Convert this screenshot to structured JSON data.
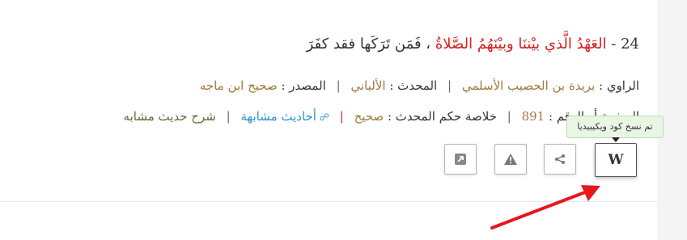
{
  "hadith": {
    "number_prefix": "24 - ",
    "quote": "العَهْدُ الَّذي بيْننَا وبيْنَهُمُ الصَّلاةُ",
    "rest": " ، فَمَن تَرَكَها فقد كفَرَ"
  },
  "details": {
    "narrator_label": "الراوي : ",
    "narrator_value": "بريدة بن الحصيب الأسلمي",
    "muhaddith_label": "المحدث : ",
    "muhaddith_value": "الألباني",
    "source_label": "المصدر : ",
    "source_value": "صحيح ابن ماجه",
    "page_label": "الصفحة أو الرقم : ",
    "page_value": "891",
    "ruling_label": "خلاصة حكم المحدث : ",
    "ruling_value": "صحيح",
    "similar_link": "أحاديث مشابهة",
    "similar_icon": "link-icon",
    "explain_link": "شرح حديث مشابه",
    "separator": "|"
  },
  "tooltip": {
    "text": "تم نسخ كود ويكيبيديا"
  },
  "actions": {
    "wiki_label": "W",
    "wiki_icon": "wikipedia-icon",
    "share_icon": "share-icon",
    "warn_icon": "warning-icon",
    "external_icon": "external-link-icon"
  },
  "colors": {
    "quote_red": "#d42020",
    "value_gold": "#a07a3e",
    "link_blue": "#2f8fd8",
    "link_green": "#5a6e3a",
    "tooltip_bg": "#eaf6e4",
    "arrow_red": "#e3181d"
  }
}
